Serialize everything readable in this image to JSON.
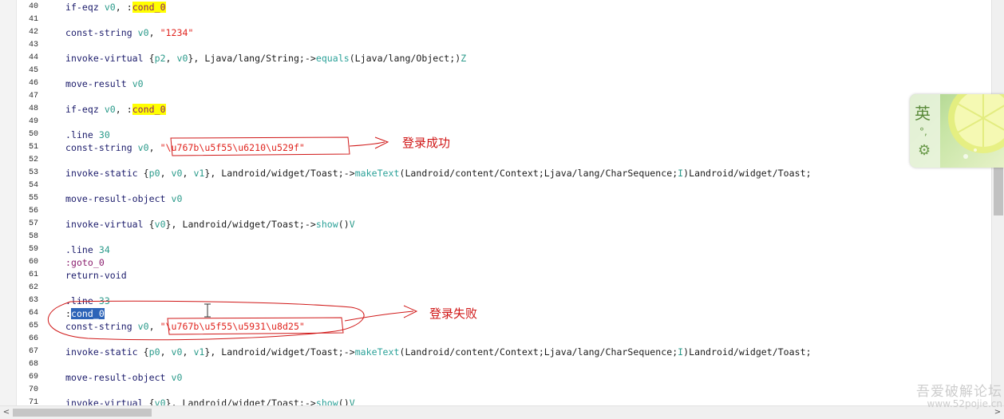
{
  "editor": {
    "lines": [
      {
        "n": "40",
        "tokens": [
          {
            "t": "if-eqz ",
            "c": "dir"
          },
          {
            "t": "v0",
            "c": "reg"
          },
          {
            "t": ", :"
          },
          {
            "t": "cond_0",
            "c": "lbl",
            "h": "yellow"
          }
        ]
      },
      {
        "n": "41",
        "tokens": []
      },
      {
        "n": "42",
        "tokens": [
          {
            "t": "const-string ",
            "c": "dir"
          },
          {
            "t": "v0",
            "c": "reg"
          },
          {
            "t": ", "
          },
          {
            "t": "\"1234\"",
            "c": "str"
          }
        ]
      },
      {
        "n": "43",
        "tokens": []
      },
      {
        "n": "44",
        "tokens": [
          {
            "t": "invoke-virtual ",
            "c": "dir"
          },
          {
            "t": "{"
          },
          {
            "t": "p2",
            "c": "reg"
          },
          {
            "t": ", "
          },
          {
            "t": "v0",
            "c": "reg"
          },
          {
            "t": "}, Ljava/lang/String;->"
          },
          {
            "t": "equals",
            "c": "meth"
          },
          {
            "t": "(Ljava/lang/Object;)"
          },
          {
            "t": "Z",
            "c": "type"
          }
        ]
      },
      {
        "n": "45",
        "tokens": []
      },
      {
        "n": "46",
        "tokens": [
          {
            "t": "move-result ",
            "c": "dir"
          },
          {
            "t": "v0",
            "c": "reg"
          }
        ]
      },
      {
        "n": "47",
        "tokens": []
      },
      {
        "n": "48",
        "tokens": [
          {
            "t": "if-eqz ",
            "c": "dir"
          },
          {
            "t": "v0",
            "c": "reg"
          },
          {
            "t": ", :"
          },
          {
            "t": "cond_0",
            "c": "lbl",
            "h": "yellow"
          }
        ]
      },
      {
        "n": "49",
        "tokens": []
      },
      {
        "n": "50",
        "tokens": [
          {
            "t": ".line ",
            "c": "dir"
          },
          {
            "t": "30",
            "c": "num"
          }
        ]
      },
      {
        "n": "51",
        "tokens": [
          {
            "t": "const-string ",
            "c": "dir"
          },
          {
            "t": "v0",
            "c": "reg"
          },
          {
            "t": ", "
          },
          {
            "t": "\"\\u767b\\u5f55\\u6210\\u529f\"",
            "c": "str"
          }
        ]
      },
      {
        "n": "52",
        "tokens": []
      },
      {
        "n": "53",
        "tokens": [
          {
            "t": "invoke-static ",
            "c": "dir"
          },
          {
            "t": "{"
          },
          {
            "t": "p0",
            "c": "reg"
          },
          {
            "t": ", "
          },
          {
            "t": "v0",
            "c": "reg"
          },
          {
            "t": ", "
          },
          {
            "t": "v1",
            "c": "reg"
          },
          {
            "t": "}, Landroid/widget/Toast;->"
          },
          {
            "t": "makeText",
            "c": "meth"
          },
          {
            "t": "(Landroid/content/Context;Ljava/lang/CharSequence;"
          },
          {
            "t": "I",
            "c": "type"
          },
          {
            "t": ")Landroid/widget/Toast;"
          }
        ]
      },
      {
        "n": "54",
        "tokens": []
      },
      {
        "n": "55",
        "tokens": [
          {
            "t": "move-result-object ",
            "c": "dir"
          },
          {
            "t": "v0",
            "c": "reg"
          }
        ]
      },
      {
        "n": "56",
        "tokens": []
      },
      {
        "n": "57",
        "tokens": [
          {
            "t": "invoke-virtual ",
            "c": "dir"
          },
          {
            "t": "{"
          },
          {
            "t": "v0",
            "c": "reg"
          },
          {
            "t": "}, Landroid/widget/Toast;->"
          },
          {
            "t": "show",
            "c": "meth"
          },
          {
            "t": "()"
          },
          {
            "t": "V",
            "c": "type"
          }
        ]
      },
      {
        "n": "58",
        "tokens": []
      },
      {
        "n": "59",
        "tokens": [
          {
            "t": ".line ",
            "c": "dir"
          },
          {
            "t": "34",
            "c": "num"
          }
        ]
      },
      {
        "n": "60",
        "tokens": [
          {
            "t": ":goto_0",
            "c": "lbl"
          }
        ]
      },
      {
        "n": "61",
        "tokens": [
          {
            "t": "return-void",
            "c": "dir"
          }
        ]
      },
      {
        "n": "62",
        "tokens": []
      },
      {
        "n": "63",
        "tokens": [
          {
            "t": ".line ",
            "c": "dir"
          },
          {
            "t": "33",
            "c": "num"
          }
        ]
      },
      {
        "n": "64",
        "tokens": [
          {
            "t": ":"
          },
          {
            "t": "cond_0",
            "c": "lbl",
            "h": "sel"
          }
        ]
      },
      {
        "n": "65",
        "tokens": [
          {
            "t": "const-string ",
            "c": "dir"
          },
          {
            "t": "v0",
            "c": "reg"
          },
          {
            "t": ", "
          },
          {
            "t": "\"\\u767b\\u5f55\\u5931\\u8d25\"",
            "c": "str"
          }
        ]
      },
      {
        "n": "66",
        "tokens": []
      },
      {
        "n": "67",
        "tokens": [
          {
            "t": "invoke-static ",
            "c": "dir"
          },
          {
            "t": "{"
          },
          {
            "t": "p0",
            "c": "reg"
          },
          {
            "t": ", "
          },
          {
            "t": "v0",
            "c": "reg"
          },
          {
            "t": ", "
          },
          {
            "t": "v1",
            "c": "reg"
          },
          {
            "t": "}, Landroid/widget/Toast;->"
          },
          {
            "t": "makeText",
            "c": "meth"
          },
          {
            "t": "(Landroid/content/Context;Ljava/lang/CharSequence;"
          },
          {
            "t": "I",
            "c": "type"
          },
          {
            "t": ")Landroid/widget/Toast;"
          }
        ]
      },
      {
        "n": "68",
        "tokens": []
      },
      {
        "n": "69",
        "tokens": [
          {
            "t": "move-result-object ",
            "c": "dir"
          },
          {
            "t": "v0",
            "c": "reg"
          }
        ]
      },
      {
        "n": "70",
        "tokens": []
      },
      {
        "n": "71",
        "tokens": [
          {
            "t": "invoke-virtual ",
            "c": "dir"
          },
          {
            "t": "{"
          },
          {
            "t": "v0",
            "c": "reg"
          },
          {
            "t": "}, Landroid/widget/Toast;->"
          },
          {
            "t": "show",
            "c": "meth"
          },
          {
            "t": "()"
          },
          {
            "t": "V",
            "c": "type"
          }
        ]
      }
    ]
  },
  "annotations": {
    "success_label": "登录成功",
    "failure_label": "登录失败",
    "color": "#d01818"
  },
  "ime": {
    "language": "英",
    "punctuation": "°,",
    "settings_icon": "gear-icon"
  },
  "scrollbars": {
    "left_arrow": "<",
    "right_arrow": ">"
  },
  "watermark": {
    "line1": "吾爱破解论坛",
    "line2": "www.52pojie.cn"
  }
}
